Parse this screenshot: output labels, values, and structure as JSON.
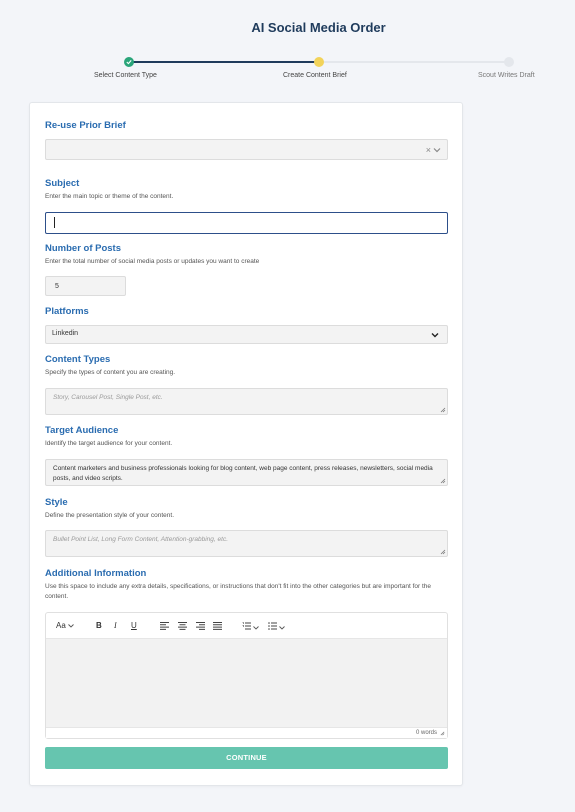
{
  "header": {
    "title": "AI Social Media Order"
  },
  "stepper": {
    "steps": [
      {
        "label": "Select Content Type",
        "status": "complete"
      },
      {
        "label": "Create Content Brief",
        "status": "current"
      },
      {
        "label": "Scout Writes Draft",
        "status": "pending"
      }
    ]
  },
  "form": {
    "reuse": {
      "title": "Re-use Prior Brief",
      "value": "",
      "clear_icon": "×"
    },
    "subject": {
      "title": "Subject",
      "description": "Enter the main topic or theme of the content.",
      "value": ""
    },
    "num_posts": {
      "title": "Number of Posts",
      "description": "Enter the total number of social media posts or updates you want to create",
      "value": "5"
    },
    "platforms": {
      "title": "Platforms",
      "value": "Linkedin"
    },
    "content_types": {
      "title": "Content Types",
      "description": "Specify the types of content you are creating.",
      "placeholder": "Story, Carousel Post, Single Post, etc."
    },
    "target_audience": {
      "title": "Target Audience",
      "description": "Identify the target audience for your content.",
      "value": "Content marketers and business professionals looking for blog content, web page content, press releases, newsletters, social media posts, and video scripts."
    },
    "style": {
      "title": "Style",
      "description": "Define the presentation style of your content.",
      "placeholder": "Bullet Point List, Long Form Content, Attention-grabbing, etc."
    },
    "additional": {
      "title": "Additional Information",
      "description": "Use this space to include any extra details, specifications, or instructions that don't fit into the other categories but are important for the content.",
      "toolbar": {
        "font": "Aa",
        "bold": "B",
        "italic": "I",
        "underline": "U"
      },
      "word_count": "0 words"
    },
    "continue_label": "CONTINUE"
  },
  "colors": {
    "accent": "#2a6cb0",
    "complete": "#2aa57a",
    "current": "#f2d35a",
    "button": "#66c5af"
  }
}
